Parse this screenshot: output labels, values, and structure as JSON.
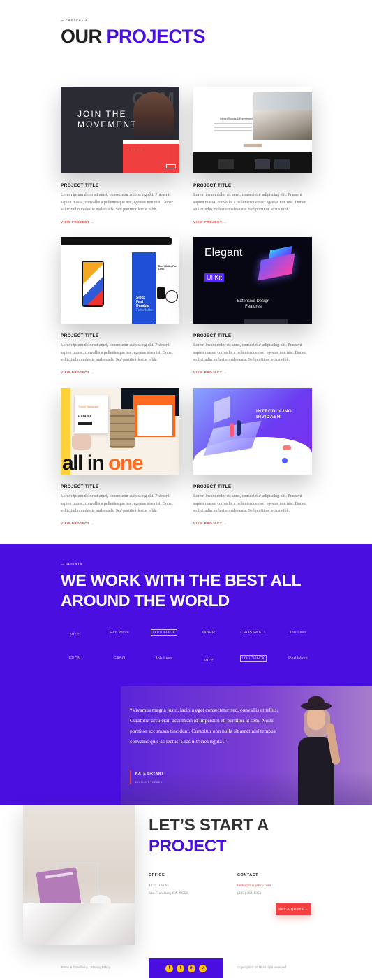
{
  "portfolio": {
    "eyebrow": "— PORTFOLIO",
    "title_part1": "OUR",
    "title_part2": "PROJECTS"
  },
  "projects": [
    {
      "title": "PROJECT TITLE",
      "description": "Lorem ipsum dolor sit amet, consectetur adipiscing elit. Praesent sapien massa, convallis a pellentesque nec, egestas non nisi. Donec sollicitudin molestie malesuada. Sed porttitor lectus nibh.",
      "link": "VIEW PROJECT →",
      "thumb": {
        "headline": "JOIN THE MOVEMENT",
        "bg_text": "GYM"
      }
    },
    {
      "title": "PROJECT TITLE",
      "description": "Lorem ipsum dolor sit amet, consectetur adipiscing elit. Praesent sapien massa, convallis a pellentesque nec, egestas non nisi. Donec sollicitudin molestie malesuada. Sed porttitor lectus nibh.",
      "link": "VIEW PROJECT →",
      "thumb": {
        "headline": "Interior Spaces & Experiences"
      }
    },
    {
      "title": "PROJECT TITLE",
      "description": "Lorem ipsum dolor sit amet, consectetur adipiscing elit. Praesent sapien massa, convallis a pellentesque nec, egestas non nisi. Donec sollicitudin molestie malesuada. Sed porttitor lectus nibh.",
      "link": "VIEW PROJECT →",
      "thumb": {
        "side_text": "Don't Settle For Less",
        "panel_line1": "Sleek",
        "panel_line2": "Fast",
        "panel_line3": "Durable",
        "panel_line4": "Futuristic"
      }
    },
    {
      "title": "PROJECT TITLE",
      "description": "Lorem ipsum dolor sit amet, consectetur adipiscing elit. Praesent sapien massa, convallis a pellentesque nec, egestas non nisi. Donec sollicitudin molestie malesuada. Sed porttitor lectus nibh.",
      "link": "VIEW PROJECT →",
      "thumb": {
        "headline": "Elegant",
        "badge": "UI Kit",
        "sub1": "Extensive Design",
        "sub2": "Features"
      }
    },
    {
      "title": "PROJECT TITLE",
      "description": "Lorem ipsum dolor sit amet, consectetur adipiscing elit. Praesent sapien massa, convallis a pellentesque nec, egestas non nisi. Donec sollicitudin molestie malesuada. Sed porttitor lectus nibh.",
      "link": "VIEW PROJECT →",
      "thumb": {
        "card_label": "Travel Backpack",
        "price": "£134.00",
        "big_a": "all in ",
        "big_b": "one"
      }
    },
    {
      "title": "PROJECT TITLE",
      "description": "Lorem ipsum dolor sit amet, consectetur adipiscing elit. Praesent sapien massa, convallis a pellentesque nec, egestas non nisi. Donec sollicitudin molestie malesuada. Sed porttitor lectus nibh.",
      "link": "VIEW PROJECT →",
      "thumb": {
        "headline_1": "INTRODUCING",
        "headline_2": "DIVIDASH"
      }
    }
  ],
  "clients": {
    "eyebrow": "— CLIENTS",
    "title_line1": "WE WORK WITH THE BEST ALL",
    "title_line2": "AROUND THE WORLD",
    "logos_row1": [
      "uire",
      "Red Wave",
      "LOUDHACK",
      "INNER",
      "CROSSWELL",
      "Joh Lees"
    ],
    "logos_row2": [
      "ERON",
      "GABO",
      "Joh Lees",
      "uire",
      "LOUDHACK",
      "Red Wave"
    ]
  },
  "testimonial": {
    "quote": "“Vivamus magna justo, lacinia eget consectetur sed, convallis at tellus. Curabitur arcu erat, accumsan id imperdiet et, porttitor at sem. Nulla porttitor accumsan tincidunt. Curabitur non nulla sit amet nisl tempus convallis quis ac lectus. Cras ultricies ligula .”",
    "name": "KATE BRYANT",
    "role": "ELEGANT THEMES"
  },
  "cta": {
    "title_line1": "LET’S START A",
    "title_line2": "PROJECT",
    "office_label": "OFFICE",
    "office_line1": "1234 Divi St.",
    "office_line2": "San Francisco, CA 29351",
    "contact_label": "CONTACT",
    "contact_email": "hello@divigency.com",
    "contact_phone": "(235) 462-1351",
    "button": "GET A QUOTE →"
  },
  "footer": {
    "left": "Terms & Conditions | Privacy Policy",
    "right": "Copyright © 2019 All right reserved.",
    "social": [
      "f",
      "t",
      "in",
      "v"
    ]
  },
  "colors": {
    "accent": "#4a0fe0",
    "link_red": "#e53935",
    "button_red": "#f44040",
    "social_yellow": "#ffc400"
  }
}
